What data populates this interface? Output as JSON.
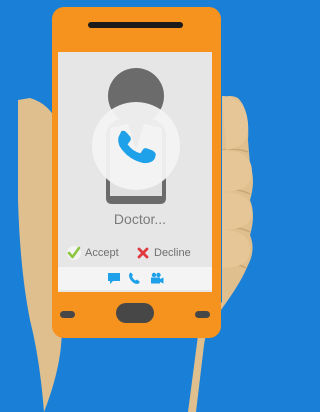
{
  "call": {
    "caller_name": "Doctor...",
    "accept_label": "Accept",
    "decline_label": "Decline"
  },
  "icons": {
    "call": "phone-icon",
    "accept": "check-icon",
    "decline": "x-icon",
    "chat": "chat-bubble-icon",
    "phone": "phone-icon",
    "video": "video-camera-icon"
  },
  "colors": {
    "background": "#1a7fd6",
    "phone_body": "#f6921e",
    "screen": "#e6e6e6",
    "accent_blue": "#1ea1e8",
    "accept": "#8cc63f",
    "decline": "#e0393e",
    "hand": "#e0bf8e"
  }
}
